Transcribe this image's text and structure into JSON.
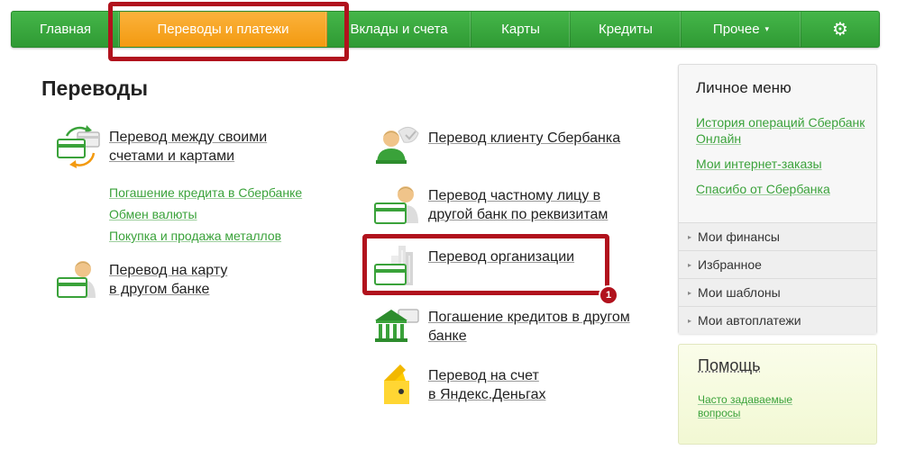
{
  "nav": {
    "items": [
      "Главная",
      "Переводы и платежи",
      "Вклады и счета",
      "Карты",
      "Кредиты",
      "Прочее"
    ],
    "active_index": 1,
    "dropdown_caret": "▾",
    "settings_icon": "gear-icon"
  },
  "page": {
    "title": "Переводы"
  },
  "transfers": {
    "own_accounts": {
      "line1": "Перевод между своими",
      "line2": "счетами и картами",
      "icon": "transfer-cards-icon"
    },
    "sublinks": [
      "Погашение кредита в Сбербанке",
      "Обмен валюты",
      "Покупка и продажа металлов"
    ],
    "card_other_bank": {
      "line1": "Перевод на карту",
      "line2": "в другом банке",
      "icon": "person-card-icon"
    },
    "sber_client": {
      "line1": "Перевод клиенту Сбербанка",
      "icon": "person-icon"
    },
    "private_person": {
      "line1": "Перевод частному лицу в",
      "line2": "другой банк по реквизитам",
      "icon": "person-card-icon"
    },
    "organization": {
      "line1": "Перевод организации",
      "icon": "building-card-icon"
    },
    "loan_other_bank": {
      "line1": "Погашение кредитов в другом",
      "line2": "банке",
      "icon": "bank-icon"
    },
    "yandex": {
      "line1": "Перевод на счет",
      "line2": "в Яндекс.Деньгах",
      "icon": "yandex-wallet-icon"
    }
  },
  "annotation": {
    "step": "1"
  },
  "sidebar": {
    "personal_title": "Личное меню",
    "links": [
      "История операций Сбербанк Онлайн",
      "Мои интернет-заказы",
      "Спасибо от Сбербанка"
    ],
    "menu": [
      "Мои финансы",
      "Избранное",
      "Мои шаблоны",
      "Мои автоплатежи"
    ],
    "menu_marker": "▸",
    "help_title": "Помощь",
    "help_link": "Часто задаваемые вопросы"
  },
  "colors": {
    "nav_green": "#34a338",
    "nav_active": "#f7a52a",
    "link_green": "#3aa23a",
    "highlight_red": "#b1121d"
  }
}
